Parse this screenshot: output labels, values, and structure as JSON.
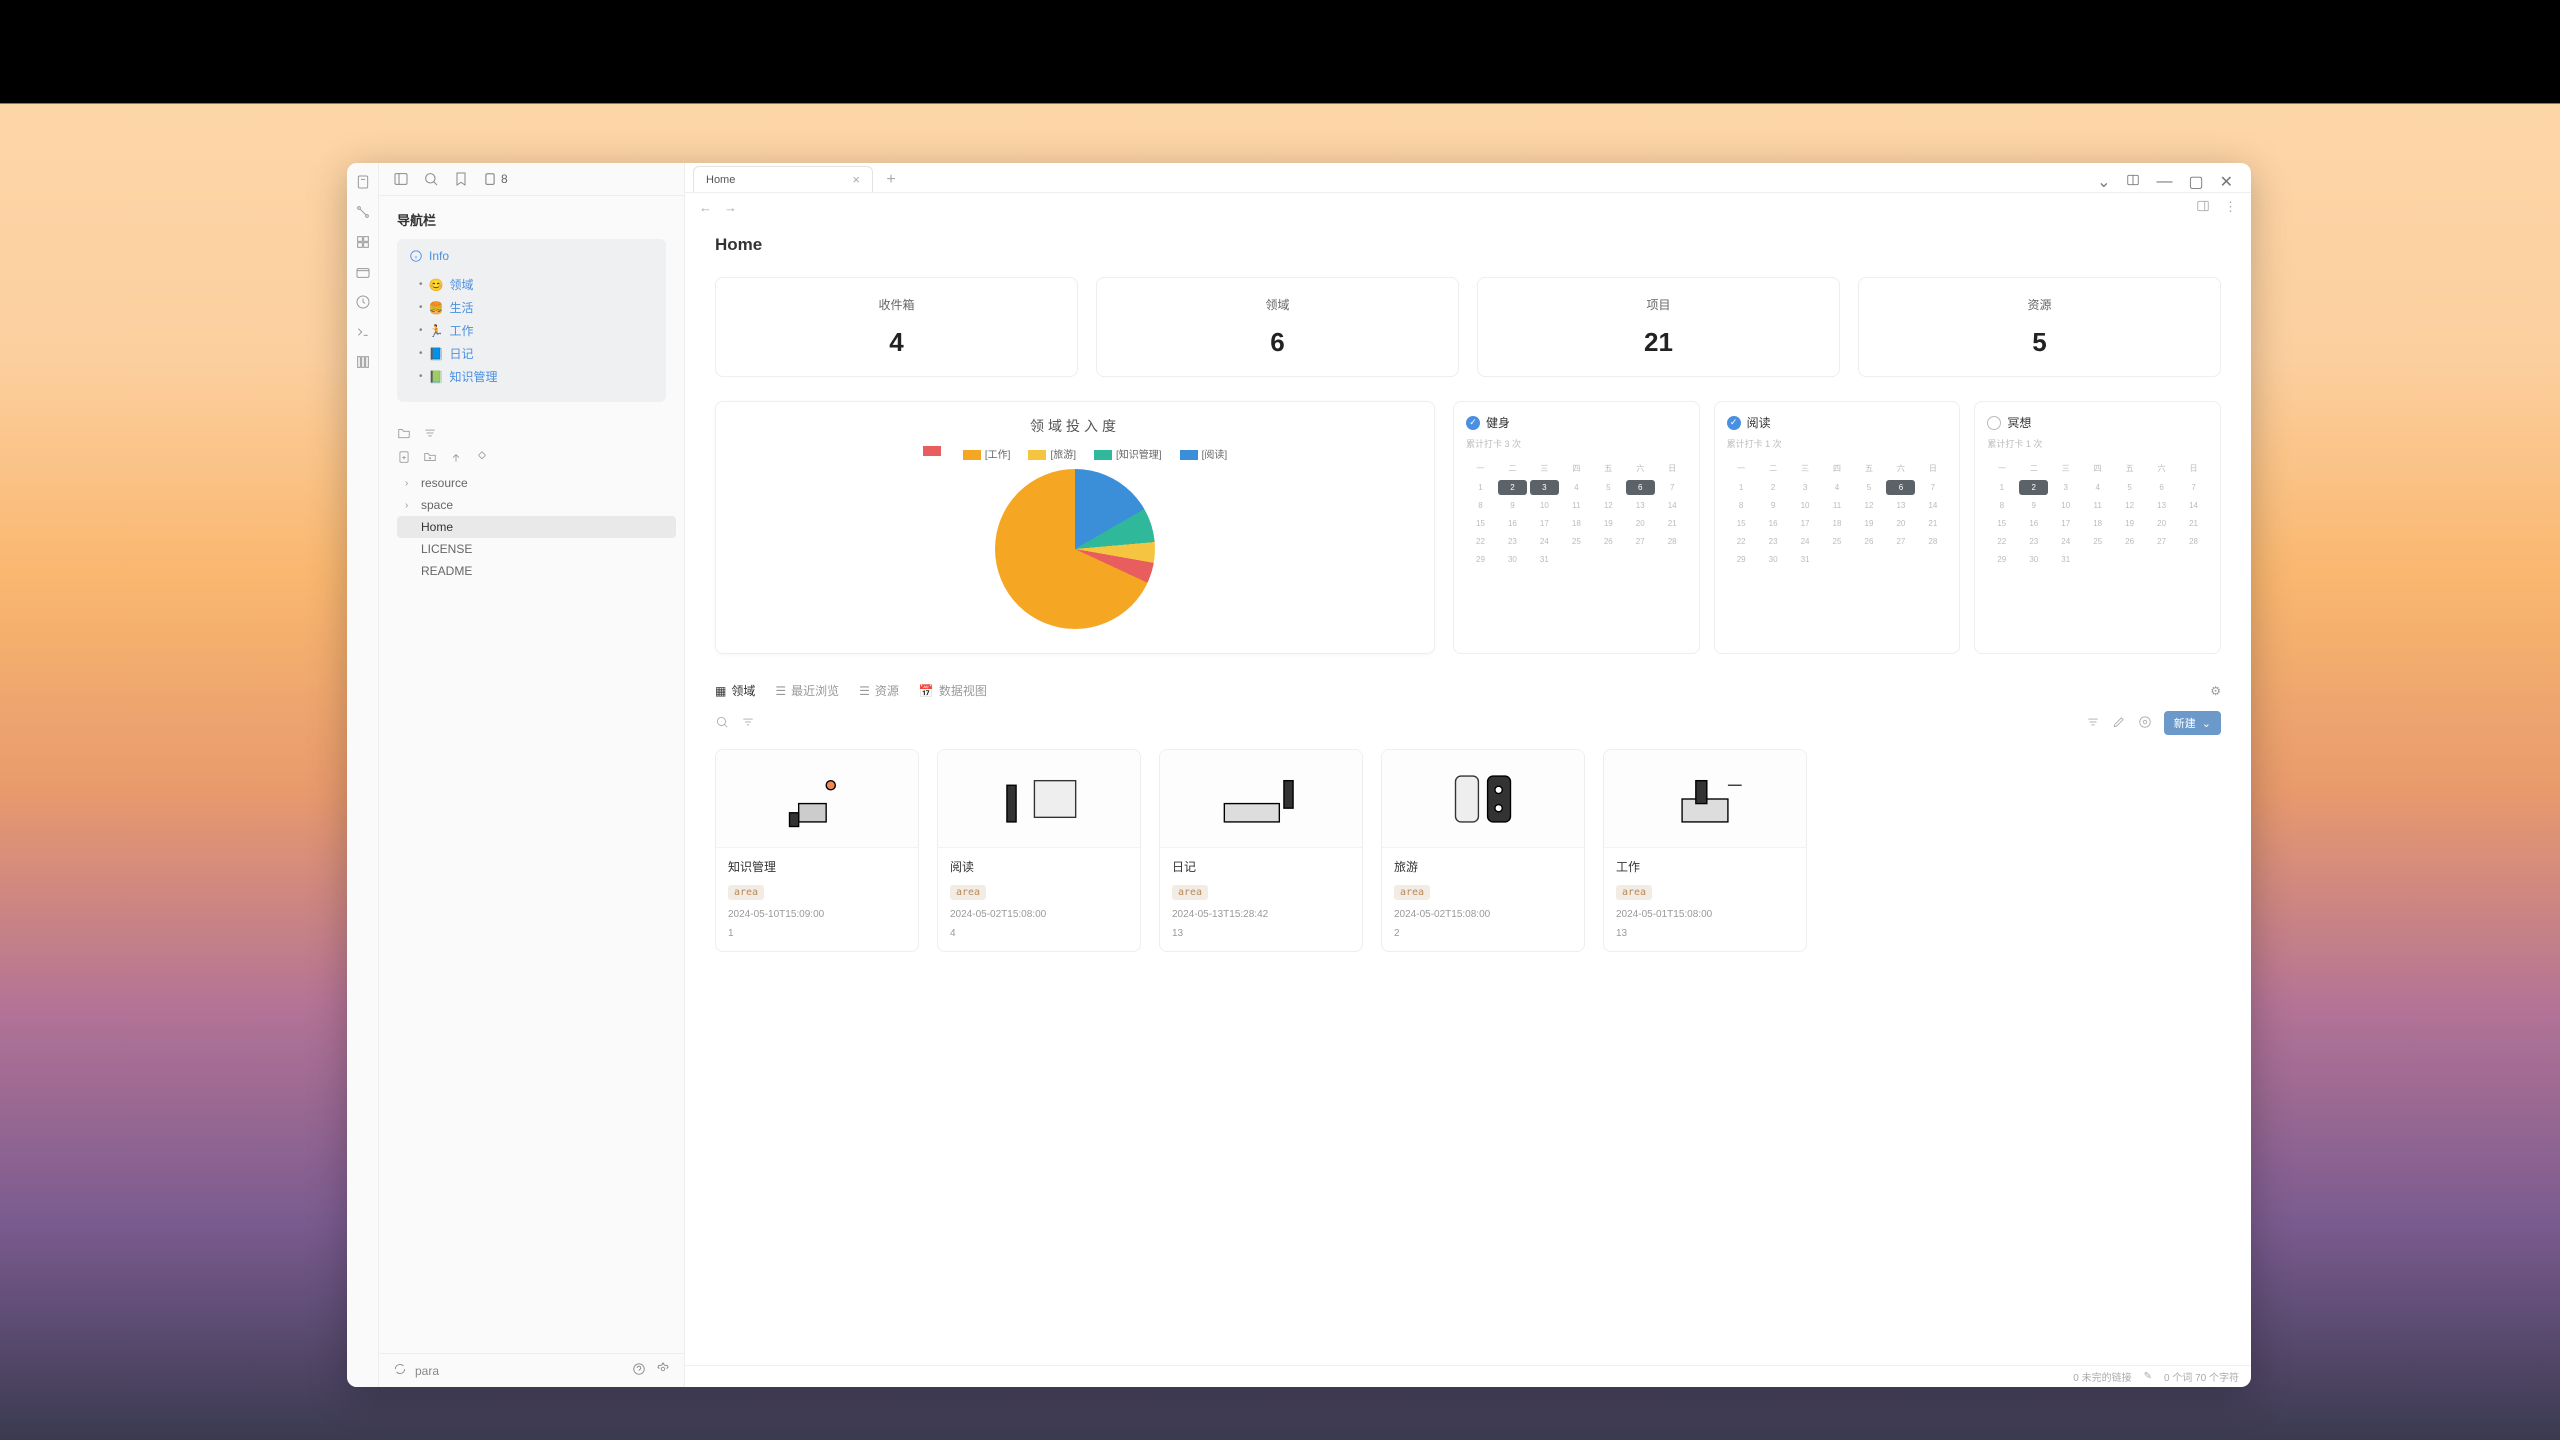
{
  "tab": {
    "title": "Home"
  },
  "page": {
    "title": "Home"
  },
  "sidebar": {
    "doc_label": "8",
    "nav_title": "导航栏",
    "info_label": "Info",
    "nav_items": [
      {
        "emoji": "😊",
        "label": "领域"
      },
      {
        "emoji": "🍔",
        "label": "生活"
      },
      {
        "emoji": "🏃",
        "label": "工作"
      },
      {
        "emoji": "📘",
        "label": "日记"
      },
      {
        "emoji": "📗",
        "label": "知识管理"
      }
    ],
    "files": {
      "folders": [
        {
          "label": "resource"
        },
        {
          "label": "space"
        }
      ],
      "docs": [
        {
          "label": "Home",
          "selected": true
        },
        {
          "label": "LICENSE",
          "selected": false
        },
        {
          "label": "README",
          "selected": false
        }
      ]
    },
    "footer_label": "para"
  },
  "stats": [
    {
      "label": "收件箱",
      "value": "4"
    },
    {
      "label": "领域",
      "value": "6"
    },
    {
      "label": "项目",
      "value": "21"
    },
    {
      "label": "资源",
      "value": "5"
    }
  ],
  "chart_data": {
    "type": "pie",
    "title": "领域投入度",
    "series": [
      {
        "name": "",
        "color": "#e85d5d",
        "value": 4
      },
      {
        "name": "[工作]",
        "color": "#f5a623",
        "value": 68
      },
      {
        "name": "[旅游]",
        "color": "#f5c542",
        "value": 4
      },
      {
        "name": "[知识管理]",
        "color": "#2fb89a",
        "value": 7
      },
      {
        "name": "[阅读]",
        "color": "#3b8fd9",
        "value": 17
      }
    ]
  },
  "habits": [
    {
      "title": "健身",
      "done": true,
      "sub": "累计打卡 3 次",
      "marks": [
        2,
        3,
        6
      ]
    },
    {
      "title": "阅读",
      "done": true,
      "sub": "累计打卡 1 次",
      "marks": [
        6
      ]
    },
    {
      "title": "冥想",
      "done": false,
      "sub": "累计打卡 1 次",
      "marks": [
        2
      ]
    }
  ],
  "viewtabs": [
    {
      "label": "领域",
      "active": true
    },
    {
      "label": "最近浏览",
      "active": false
    },
    {
      "label": "资源",
      "active": false
    },
    {
      "label": "数据视图",
      "active": false
    }
  ],
  "gallery_toolbar": {
    "new_label": "新建"
  },
  "gallery": [
    {
      "title": "知识管理",
      "tag": "area",
      "date": "2024-05-10T15:09:00",
      "count": "1"
    },
    {
      "title": "阅读",
      "tag": "area",
      "date": "2024-05-02T15:08:00",
      "count": "4"
    },
    {
      "title": "日记",
      "tag": "area",
      "date": "2024-05-13T15:28:42",
      "count": "13"
    },
    {
      "title": "旅游",
      "tag": "area",
      "date": "2024-05-02T15:08:00",
      "count": "2"
    },
    {
      "title": "工作",
      "tag": "area",
      "date": "2024-05-01T15:08:00",
      "count": "13"
    }
  ],
  "statusbar": {
    "links": "0 未完的链接",
    "words": "0 个词 70 个字符"
  }
}
